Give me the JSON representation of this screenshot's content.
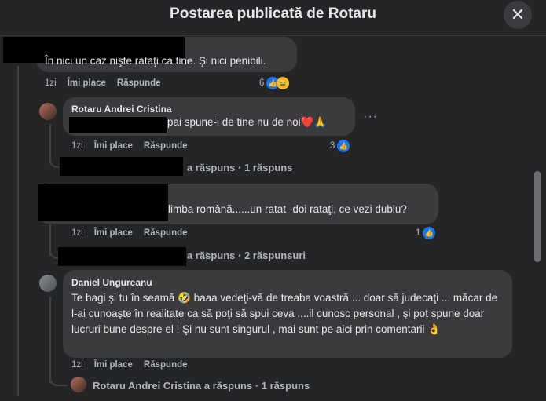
{
  "header": {
    "title": "Postarea publicată de Rotaru",
    "close_icon": "close-icon"
  },
  "comments": [
    {
      "text": "În nici un caz nişte rataţi ca tine. Şi nici penibili.",
      "time": "1zi",
      "like": "Îmi place",
      "reply": "Răspunde",
      "reaction_count": "6",
      "reactions": [
        "like-icon",
        "haha-icon"
      ]
    },
    {
      "author": "Rotaru Andrei Cristina",
      "text": "pai spune-i de tine nu de noi❤️🙏",
      "time": "1zi",
      "like": "Îmi place",
      "reply": "Răspunde",
      "reaction_count": "3",
      "reactions": [
        "like-icon"
      ],
      "more": "···"
    },
    {
      "replies_link": "a răspuns · 1 răspuns"
    },
    {
      "text": "limba română......un ratat -doi rataţi, ce vezi dublu?",
      "time": "1zi",
      "like": "Îmi place",
      "reply": "Răspunde",
      "reaction_count": "1",
      "reactions": [
        "like-icon"
      ],
      "replies_link": "a răspuns · 2 răspunsuri"
    },
    {
      "author": "Daniel Ungureanu",
      "text": "Te bagi şi tu în seamă 🤣 baaa vedeţi-vă de treaba voastră ... doar să judecaţi ... măcar de l-ai cunoaşte în realitate ca să poţi să spui ceva ....il cunosc personal , şi pot spune doar lucruri bune despre el ! Şi nu sunt singurul , mai sunt pe aici prin comentarii 👌",
      "time": "1zi",
      "like": "Îmi place",
      "reply": "Răspunde",
      "replies_link": "Rotaru Andrei Cristina a răspuns · 1 răspuns"
    }
  ],
  "colors": {
    "background": "#242526",
    "bubble": "#3a3b3c",
    "accent": "#1877f2"
  }
}
